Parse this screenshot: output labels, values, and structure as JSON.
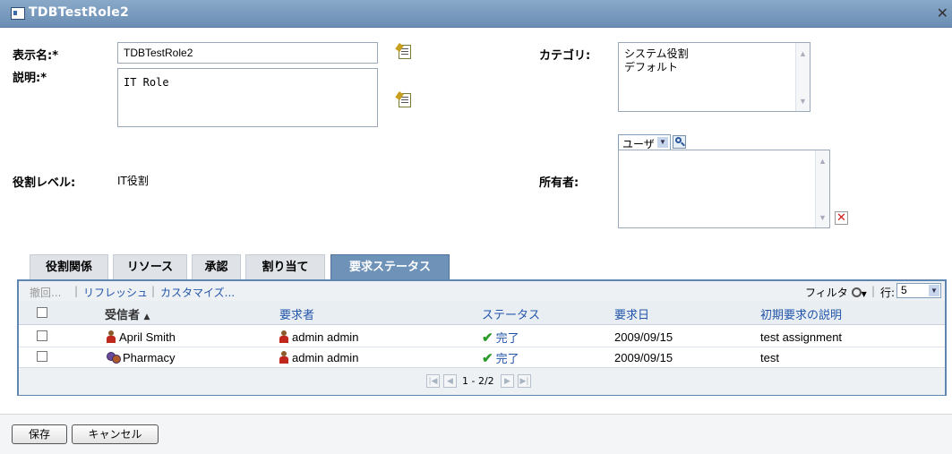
{
  "window": {
    "title": "TDBTestRole2"
  },
  "form": {
    "display_name_label": "表示名:*",
    "display_name_value": "TDBTestRole2",
    "description_label": "説明:*",
    "description_value": "IT Role",
    "category_label": "カテゴリ:",
    "categories": [
      "システム役割",
      "デフォルト"
    ],
    "role_level_label": "役割レベル:",
    "role_level_value": "IT役割",
    "owner_label": "所有者:",
    "owner_type_selected": "ユーザ"
  },
  "tabs": [
    {
      "label": "役割関係"
    },
    {
      "label": "リソース"
    },
    {
      "label": "承認"
    },
    {
      "label": "割り当て"
    },
    {
      "label": "要求ステータス",
      "active": true
    }
  ],
  "toolbar": {
    "withdraw": "撤回...",
    "refresh": "リフレッシュ",
    "customize": "カスタマイズ...",
    "filter": "フィルタ",
    "rows_label": "行:",
    "rows_value": "5"
  },
  "table": {
    "columns": [
      "受信者",
      "要求者",
      "ステータス",
      "要求日",
      "初期要求の説明"
    ],
    "sort_indicator": "▲",
    "rows": [
      {
        "recipient": "April Smith",
        "recipient_icon": "user-icon",
        "requester": "admin admin",
        "status": "完了",
        "date": "2009/09/15",
        "description": "test assignment"
      },
      {
        "recipient": "Pharmacy",
        "recipient_icon": "group-icon",
        "requester": "admin admin",
        "status": "完了",
        "date": "2009/09/15",
        "description": "test"
      }
    ],
    "pager_text": "1 - 2/2"
  },
  "buttons": {
    "save": "保存",
    "cancel": "キャンセル"
  },
  "colors": {
    "title_bar": "#7a9cc0",
    "active_tab": "#6f92b8",
    "link": "#2255aa",
    "status_check": "#2a9a2a",
    "remove": "#d01818"
  }
}
